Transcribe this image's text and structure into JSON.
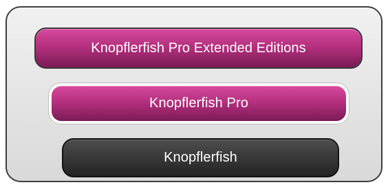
{
  "options": {
    "top_label": "Knopflerfish Pro Extended Editions",
    "middle_label": "Knopflerfish Pro",
    "bottom_label": "Knopflerfish"
  },
  "colors": {
    "accent": "#b6307f",
    "dark": "#333333",
    "panel": "#e6e6e6",
    "selected_outline": "#ffffff",
    "text": "#ffffff"
  }
}
